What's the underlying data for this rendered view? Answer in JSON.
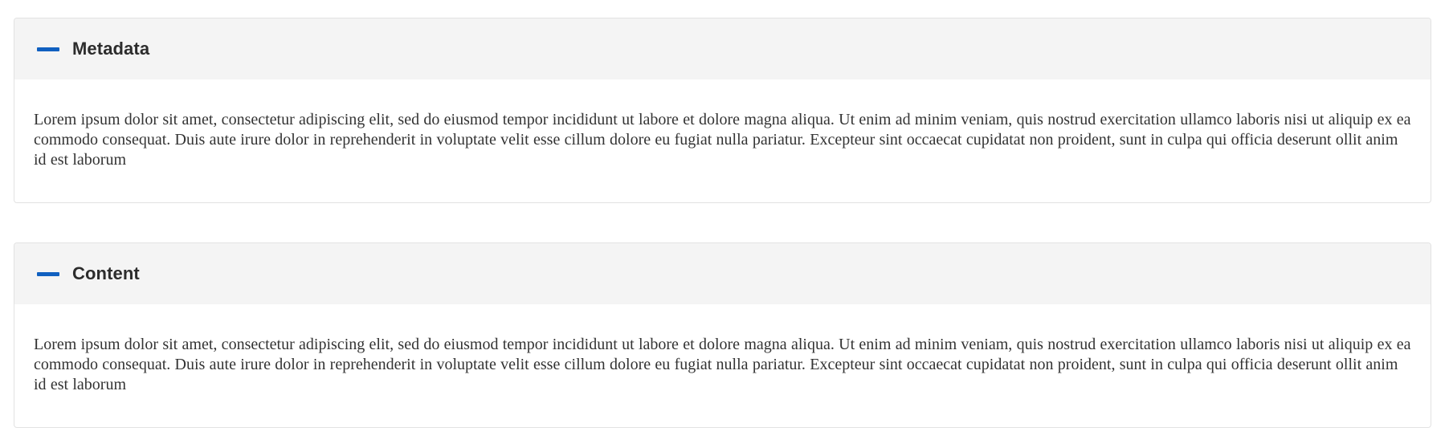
{
  "panels": [
    {
      "title": "Metadata",
      "icon": "minus-icon",
      "expanded": true,
      "body": "Lorem ipsum dolor sit amet, consectetur adipiscing elit, sed do eiusmod tempor incididunt ut labore et dolore magna aliqua. Ut enim ad minim veniam, quis nostrud exercitation ullamco laboris nisi ut aliquip ex ea commodo consequat. Duis aute irure dolor in reprehenderit in voluptate velit esse cillum dolore eu fugiat nulla pariatur. Excepteur sint occaecat cupidatat non proident, sunt in culpa qui officia deserunt ollit anim id est laborum"
    },
    {
      "title": "Content",
      "icon": "minus-icon",
      "expanded": true,
      "body": "Lorem ipsum dolor sit amet, consectetur adipiscing elit, sed do eiusmod tempor incididunt ut labore et dolore magna aliqua. Ut enim ad minim veniam, quis nostrud exercitation ullamco laboris nisi ut aliquip ex ea commodo consequat. Duis aute irure dolor in reprehenderit in voluptate velit esse cillum dolore eu fugiat nulla pariatur. Excepteur sint occaecat cupidatat non proident, sunt in culpa qui officia deserunt ollit anim id est laborum"
    }
  ],
  "colors": {
    "accent": "#1060c0",
    "header_bg": "#f4f4f4",
    "border": "#e2e2e2",
    "title_text": "#2c2c2c",
    "body_text": "#333333"
  }
}
